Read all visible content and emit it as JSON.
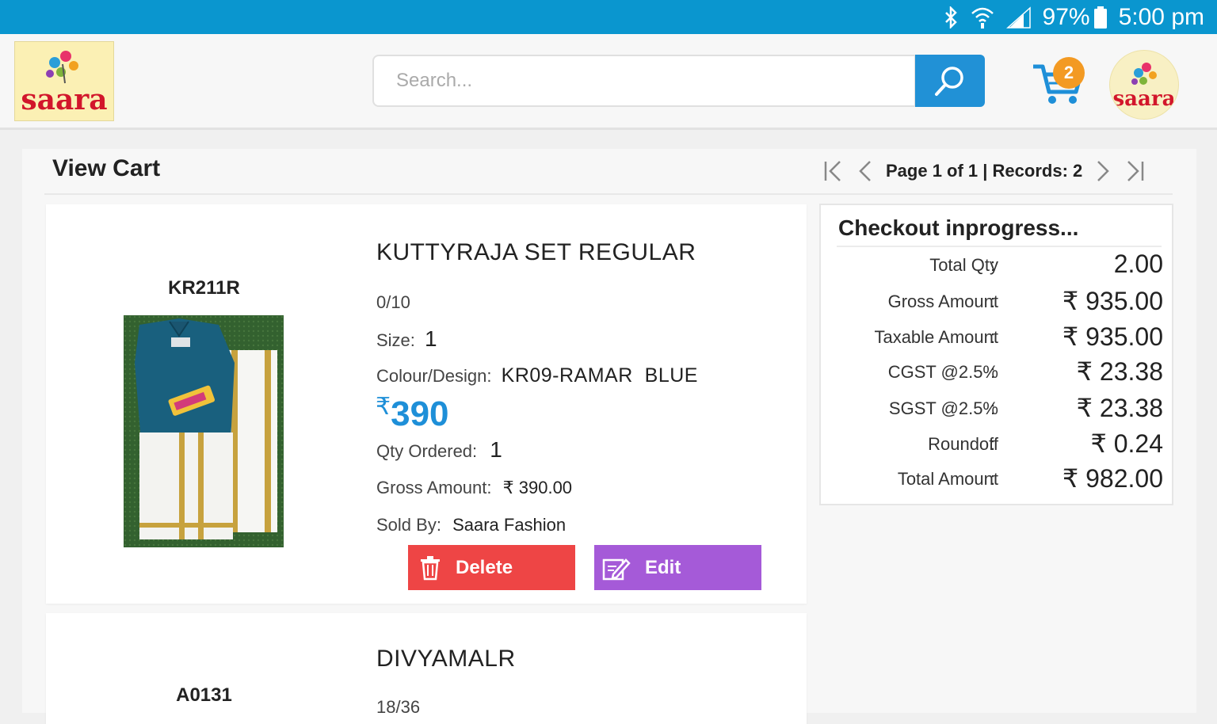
{
  "status_bar": {
    "battery": "97%",
    "time": "5:00 pm"
  },
  "header": {
    "logo_text": "saara",
    "search_placeholder": "Search...",
    "cart_count": "2"
  },
  "view": {
    "title": "View Cart",
    "pager_text": "Page 1 of 1 | Records: 2"
  },
  "items": [
    {
      "code": "KR211R",
      "name": "KUTTYRAJA SET REGULAR",
      "size_range": "0/10",
      "size_label": "Size:",
      "size": "1",
      "colour_label": "Colour/Design:",
      "colour": "KR09-RAMAR  BLUE",
      "price_symbol": "₹",
      "price": "390",
      "qty_label": "Qty Ordered:",
      "qty": "1",
      "gross_label": "Gross Amount:",
      "gross": "₹ 390.00",
      "sold_label": "Sold By:",
      "sold_by": "Saara Fashion",
      "delete_label": "Delete",
      "edit_label": "Edit"
    },
    {
      "code": "A0131",
      "name": "DIVYAMALR",
      "size_range": "18/36"
    }
  ],
  "summary": {
    "title": "Checkout inprogress...",
    "rows": [
      {
        "label": "Total Qty",
        "value": "2.00"
      },
      {
        "label": "Gross Amount",
        "value": "₹ 935.00"
      },
      {
        "label": "Taxable Amount",
        "value": "₹ 935.00"
      },
      {
        "label": "CGST @2.5%",
        "value": "₹ 23.38"
      },
      {
        "label": "SGST @2.5%",
        "value": "₹ 23.38"
      },
      {
        "label": "Roundoff",
        "value": "₹ 0.24"
      },
      {
        "label": "Total Amount",
        "value": "₹ 982.00"
      }
    ]
  },
  "colors": {
    "status_bar": "#0a96cf",
    "search_button": "#2191d6",
    "price": "#1e8fd8",
    "delete": "#ee4545",
    "edit": "#a55ad8",
    "badge": "#f39a23"
  }
}
